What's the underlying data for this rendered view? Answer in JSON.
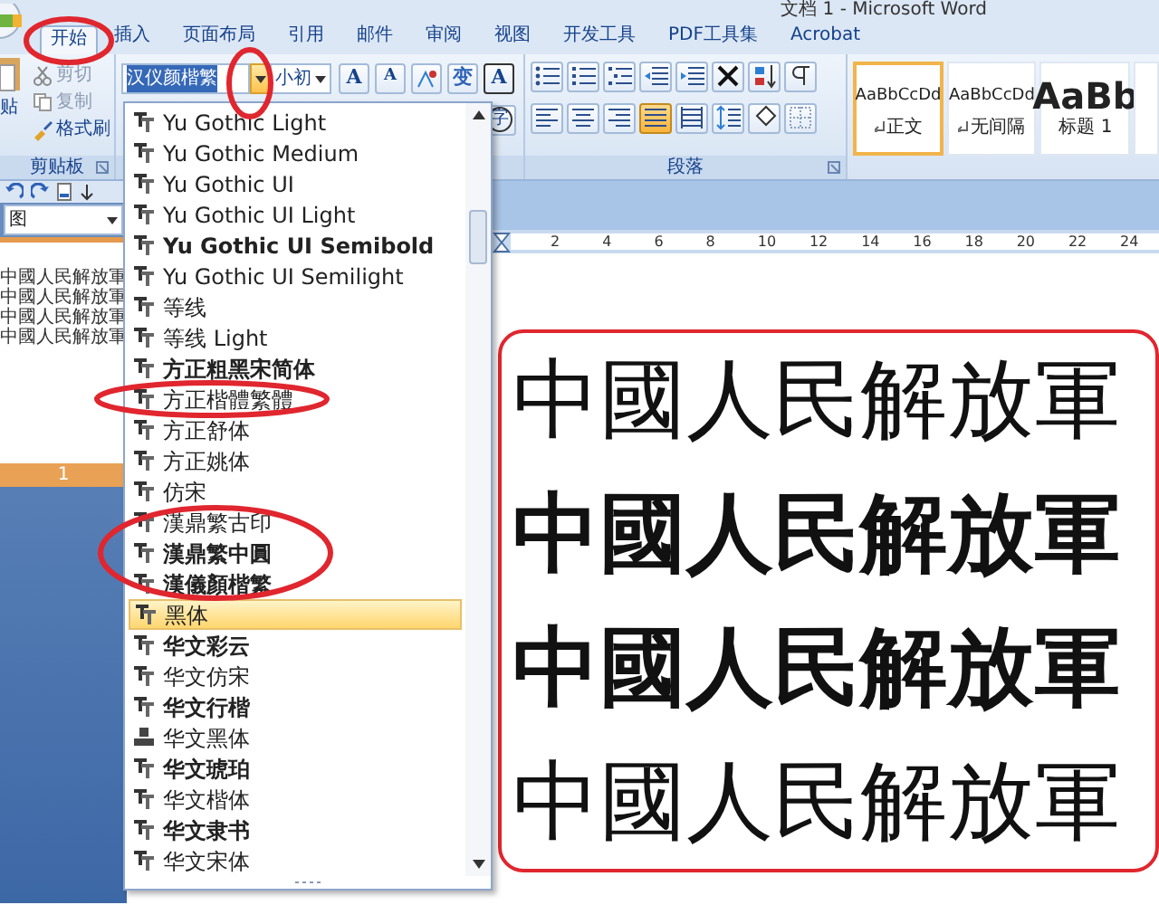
{
  "window": {
    "title": "文档 1 - Microsoft Word"
  },
  "ribbon_tabs": [
    {
      "label": "开始",
      "selected": true
    },
    {
      "label": "插入",
      "selected": false
    },
    {
      "label": "页面布局",
      "selected": false
    },
    {
      "label": "引用",
      "selected": false
    },
    {
      "label": "邮件",
      "selected": false
    },
    {
      "label": "审阅",
      "selected": false
    },
    {
      "label": "视图",
      "selected": false
    },
    {
      "label": "开发工具",
      "selected": false
    },
    {
      "label": "PDF工具集",
      "selected": false
    },
    {
      "label": "Acrobat",
      "selected": false
    }
  ],
  "clipboard_group": {
    "paste_label": "贴",
    "group_label": "剪贴板",
    "buttons": [
      {
        "kind": "cut",
        "label": "剪切",
        "disabled": true
      },
      {
        "kind": "copy",
        "label": "复制",
        "disabled": true
      },
      {
        "kind": "brush",
        "label": "格式刷",
        "disabled": false
      }
    ]
  },
  "font_group": {
    "font_name": "汉仪颜楷繁",
    "dropdown_open": true,
    "font_size": "小初",
    "tool_buttons": [
      {
        "kind": "grow",
        "text": "A"
      },
      {
        "kind": "shrink",
        "text": "A"
      },
      {
        "kind": "phonetic"
      },
      {
        "kind": "glyph",
        "text": "变"
      },
      {
        "kind": "boxed",
        "text": "A"
      }
    ],
    "enclosed_button": {
      "text": "字"
    }
  },
  "paragraph_group": {
    "group_label": "段落",
    "top_buttons": [
      {
        "kind": "bullets"
      },
      {
        "kind": "numbering"
      },
      {
        "kind": "multilevel"
      },
      {
        "kind": "outdent"
      },
      {
        "kind": "indent"
      },
      {
        "kind": "asian"
      },
      {
        "kind": "sort"
      },
      {
        "kind": "marks"
      }
    ],
    "align_buttons": [
      {
        "kind": "left",
        "selected": false
      },
      {
        "kind": "center",
        "selected": false
      },
      {
        "kind": "right",
        "selected": false
      },
      {
        "kind": "justify",
        "selected": true
      },
      {
        "kind": "distributed",
        "selected": false
      }
    ],
    "extra_buttons": [
      {
        "kind": "spacing"
      },
      {
        "kind": "shading"
      },
      {
        "kind": "borders"
      }
    ]
  },
  "styles_gallery": [
    {
      "kind": "body",
      "sample": "AaBbCcDd",
      "name": "正文",
      "selected": true
    },
    {
      "kind": "body",
      "sample": "AaBbCcDd",
      "name": "无间隔",
      "selected": false
    },
    {
      "kind": "heading",
      "sample": "AaBb",
      "name": "标题 1",
      "selected": false
    },
    {
      "selected": false
    }
  ],
  "navigation_pane": {
    "view_value": "图",
    "thumbnail_lines": [
      "中國人民解放軍",
      "中國人民解放軍",
      "中國人民解放軍",
      "中國人民解放軍"
    ],
    "page_number": "1"
  },
  "ruler_labels": [
    "2",
    "4",
    "6",
    "8",
    "10",
    "12",
    "14",
    "16",
    "18",
    "20",
    "22",
    "24"
  ],
  "font_list": [
    {
      "name": "Yu Gothic Light",
      "kind": "truetype",
      "bold": false,
      "selected": false
    },
    {
      "name": "Yu Gothic Medium",
      "kind": "truetype",
      "bold": false,
      "selected": false
    },
    {
      "name": "Yu Gothic UI",
      "kind": "truetype",
      "bold": false,
      "selected": false
    },
    {
      "name": "Yu Gothic UI Light",
      "kind": "truetype",
      "bold": false,
      "selected": false
    },
    {
      "name": "Yu Gothic UI Semibold",
      "kind": "truetype",
      "bold": true,
      "selected": false
    },
    {
      "name": "Yu Gothic UI Semilight",
      "kind": "truetype",
      "bold": false,
      "selected": false
    },
    {
      "name": "等线",
      "kind": "truetype",
      "bold": false,
      "selected": false
    },
    {
      "name": "等线 Light",
      "kind": "truetype",
      "bold": false,
      "selected": false
    },
    {
      "name": "方正粗黑宋简体",
      "kind": "truetype",
      "bold": true,
      "selected": false
    },
    {
      "name": "方正楷體繁體",
      "kind": "truetype",
      "bold": false,
      "selected": false
    },
    {
      "name": "方正舒体",
      "kind": "truetype",
      "bold": false,
      "selected": false
    },
    {
      "name": "方正姚体",
      "kind": "truetype",
      "bold": false,
      "selected": false
    },
    {
      "name": "仿宋",
      "kind": "truetype",
      "bold": false,
      "selected": false
    },
    {
      "name": "漢鼎繁古印",
      "kind": "truetype",
      "bold": false,
      "selected": false
    },
    {
      "name": "漢鼎繁中圓",
      "kind": "truetype",
      "bold": true,
      "selected": false
    },
    {
      "name": "漢儀顏楷繁",
      "kind": "truetype",
      "bold": true,
      "selected": false
    },
    {
      "name": "黑体",
      "kind": "truetype",
      "bold": false,
      "selected": true
    },
    {
      "name": "华文彩云",
      "kind": "truetype",
      "bold": true,
      "selected": false
    },
    {
      "name": "华文仿宋",
      "kind": "truetype",
      "bold": false,
      "selected": false
    },
    {
      "name": "华文行楷",
      "kind": "truetype",
      "bold": true,
      "selected": false
    },
    {
      "name": "华文黑体",
      "kind": "opentype",
      "bold": false,
      "selected": false
    },
    {
      "name": "华文琥珀",
      "kind": "truetype",
      "bold": true,
      "selected": false
    },
    {
      "name": "华文楷体",
      "kind": "truetype",
      "bold": false,
      "selected": false
    },
    {
      "name": "华文隶书",
      "kind": "truetype",
      "bold": true,
      "selected": false
    },
    {
      "name": "华文宋体",
      "kind": "truetype",
      "bold": false,
      "selected": false
    }
  ],
  "document_lines": [
    {
      "text": "中國人民解放軍",
      "bold": false
    },
    {
      "text": "中國人民解放軍",
      "bold": true
    },
    {
      "text": "中國人民解放軍",
      "bold": true
    },
    {
      "text": "中國人民解放軍",
      "bold": false
    }
  ]
}
